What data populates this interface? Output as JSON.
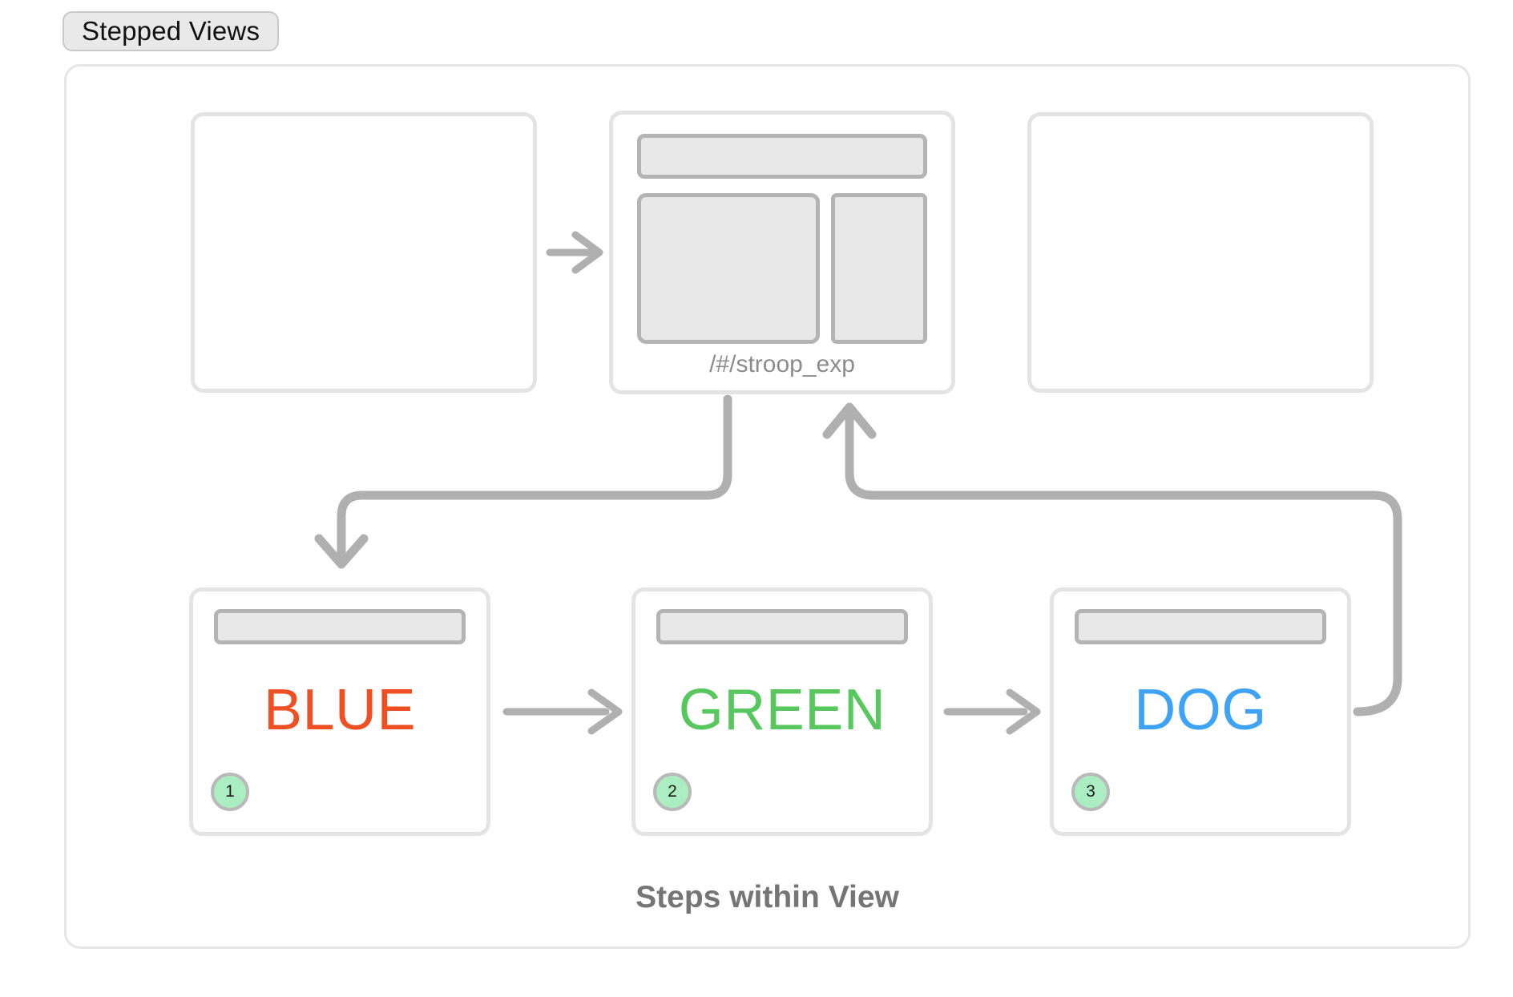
{
  "group": {
    "tag_label": "Stepped Views",
    "caption": "Steps within View"
  },
  "views": [
    {
      "name": "view-prev",
      "url": "",
      "has_wireframe": false
    },
    {
      "name": "view-stroop",
      "url": "/#/stroop_exp",
      "has_wireframe": true
    },
    {
      "name": "view-next",
      "url": "",
      "has_wireframe": false
    }
  ],
  "steps": [
    {
      "badge": "1",
      "stimulus": "BLUE",
      "color": "#f04e23"
    },
    {
      "badge": "2",
      "stimulus": "GREEN",
      "color": "#57c75e"
    },
    {
      "badge": "3",
      "stimulus": "DOG",
      "color": "#3fa3f5"
    }
  ],
  "colors": {
    "frame_border": "#e6e6e6",
    "card_border": "#e4e4e4",
    "wireframe_fill": "#e8e8e8",
    "wireframe_border": "#b4b4b4",
    "connector": "#b0b0b0",
    "badge_fill": "#abeec1",
    "badge_border": "#b9b9b9",
    "caption_text": "#757575",
    "url_text": "#8c8c8c",
    "tag_fill": "#e9e9e9"
  },
  "icons": {
    "arrow_right": "arrow-right-icon",
    "arrow_down": "arrow-down-icon",
    "arrow_up": "arrow-up-icon"
  }
}
